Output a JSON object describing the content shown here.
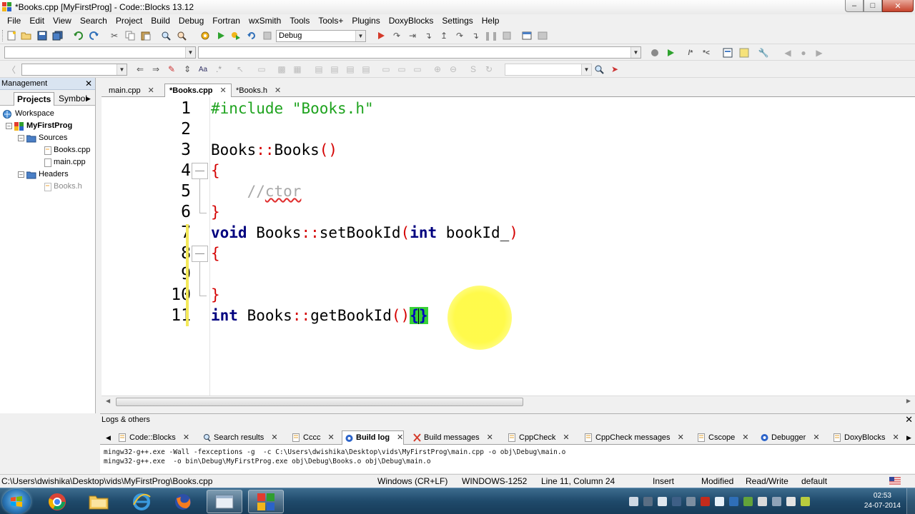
{
  "window": {
    "title": "*Books.cpp [MyFirstProg] - Code::Blocks 13.12"
  },
  "menu": [
    "File",
    "Edit",
    "View",
    "Search",
    "Project",
    "Build",
    "Debug",
    "Fortran",
    "wxSmith",
    "Tools",
    "Tools+",
    "Plugins",
    "DoxyBlocks",
    "Settings",
    "Help"
  ],
  "toolbar": {
    "build_target": "Debug"
  },
  "management": {
    "title": "Management",
    "tabs": [
      "Projects",
      "Symbol"
    ],
    "tree": {
      "workspace": "Workspace",
      "project": "MyFirstProg",
      "sources": "Sources",
      "source_files": [
        "Books.cpp",
        "main.cpp"
      ],
      "headers": "Headers",
      "header_files": [
        "Books.h"
      ]
    }
  },
  "editor": {
    "tabs": [
      "main.cpp",
      "*Books.cpp",
      "*Books.h"
    ],
    "active_tab": "*Books.cpp",
    "line_numbers": [
      "1",
      "2",
      "3",
      "4",
      "5",
      "6",
      "7",
      "8",
      "9",
      "10",
      "11"
    ],
    "code": {
      "l1_directive": "#include",
      "l1_string": "\"Books.h\"",
      "l3_name": "Books",
      "l3_sep": "::",
      "l3_func": "Books",
      "l3_parens": "()",
      "brace_open": "{",
      "brace_close": "}",
      "l5_comment_slashes": "//",
      "l5_comment_word": "ctor",
      "l7_type": "void",
      "l7_class": "Books",
      "l7_sep": "::",
      "l7_func": "setBookId",
      "l7_open": "(",
      "l7_ptype": "int",
      "l7_param": "bookId_",
      "l7_close": ")",
      "l11_type": "int",
      "l11_class": "Books",
      "l11_sep": "::",
      "l11_func": "getBookId",
      "l11_parens": "()",
      "l11_open_brace": "{",
      "l11_close_brace": "}"
    }
  },
  "logs": {
    "title": "Logs & others",
    "tabs": [
      "Code::Blocks",
      "Search results",
      "Cccc",
      "Build log",
      "Build messages",
      "CppCheck",
      "CppCheck messages",
      "Cscope",
      "Debugger",
      "DoxyBlocks"
    ],
    "active_tab": "Build log",
    "lines": [
      "mingw32-g++.exe -Wall -fexceptions -g  -c C:\\Users\\dwishika\\Desktop\\vids\\MyFirstProg\\main.cpp -o obj\\Debug\\main.o",
      "mingw32-g++.exe  -o bin\\Debug\\MyFirstProg.exe obj\\Debug\\Books.o obj\\Debug\\main.o"
    ]
  },
  "status": {
    "path": "C:\\Users\\dwishika\\Desktop\\vids\\MyFirstProg\\Books.cpp",
    "eol": "Windows (CR+LF)",
    "encoding": "WINDOWS-1252",
    "position": "Line 11, Column 24",
    "mode": "Insert",
    "modified": "Modified",
    "access": "Read/Write",
    "profile": "default"
  },
  "taskbar": {
    "time": "02:53",
    "date": "24-07-2014"
  },
  "colors": {
    "keyword": "#00007f",
    "preprocessor": "#1ea31e",
    "operator": "#d40000",
    "comment": "#a8a8a8",
    "brace_match": "#37d137",
    "change_bar": "#f4e95a"
  }
}
